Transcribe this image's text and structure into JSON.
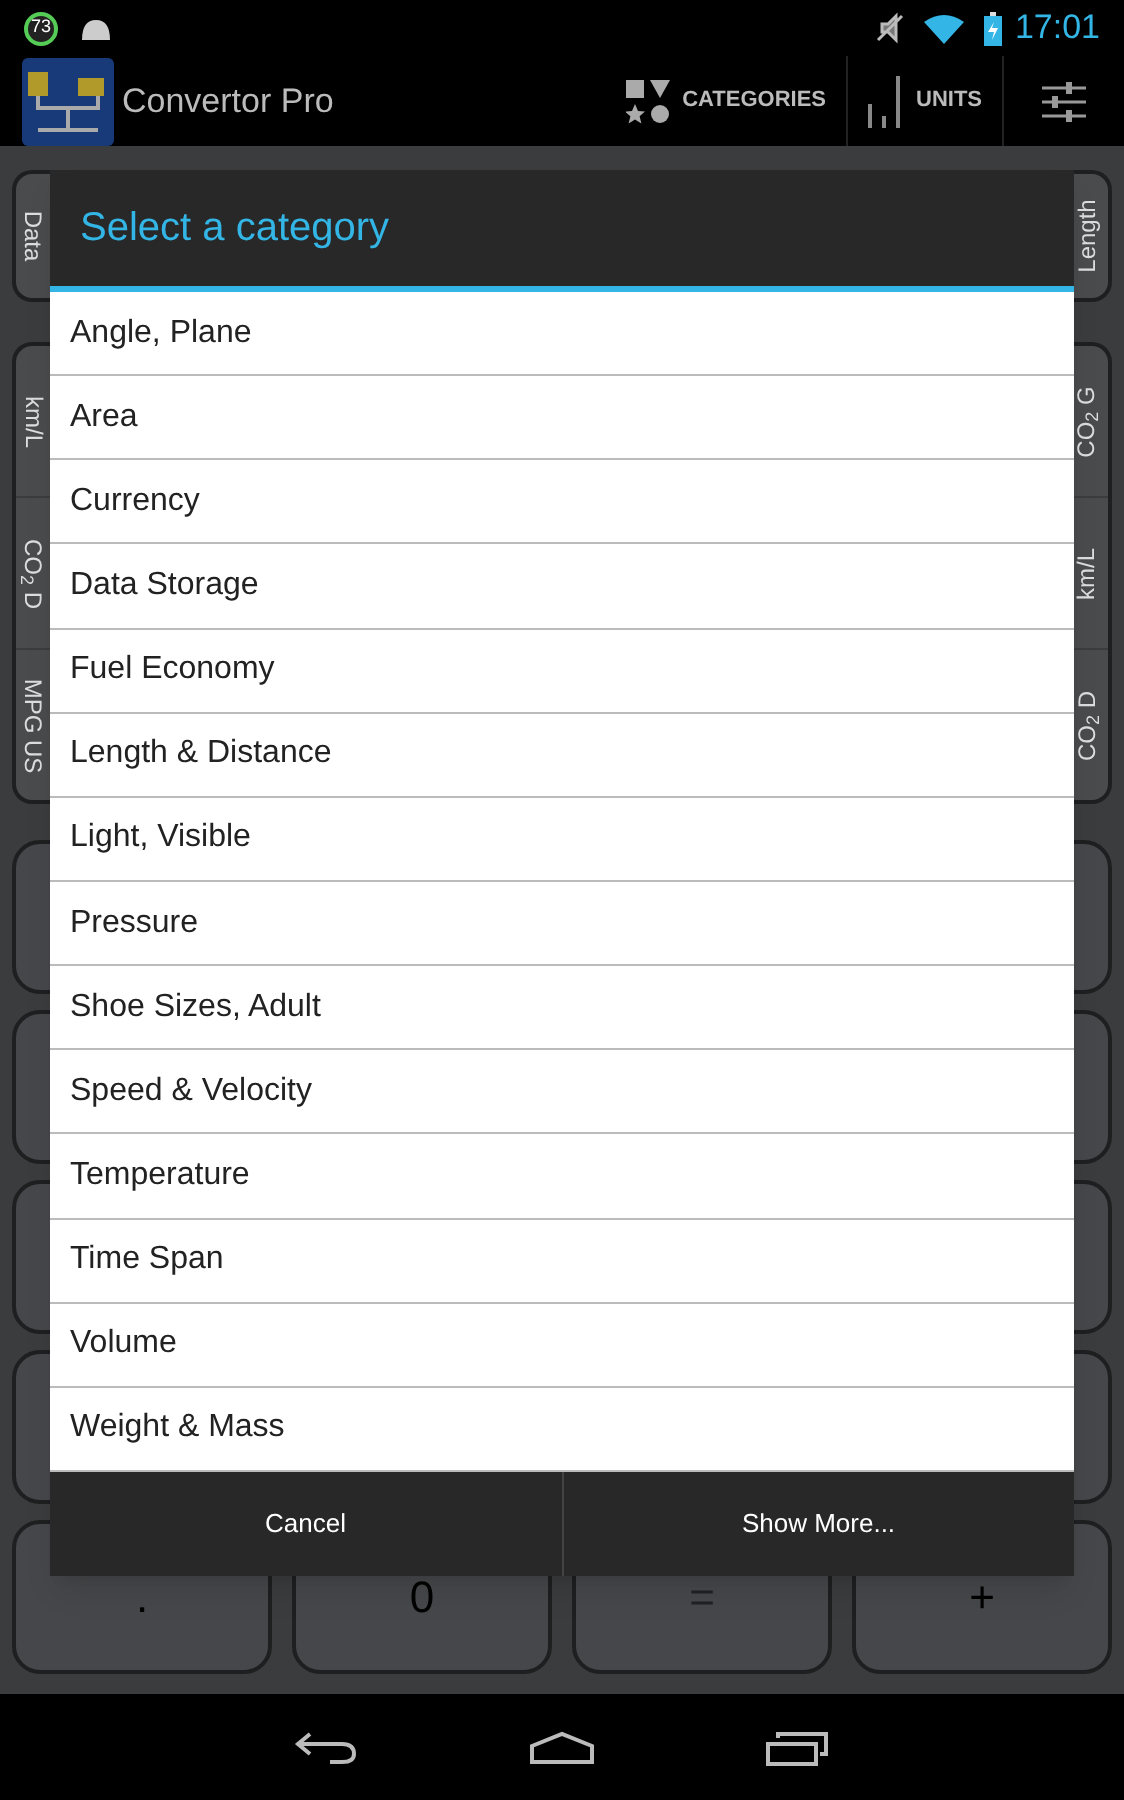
{
  "status_bar": {
    "badge": "73",
    "time": "17:01"
  },
  "action_bar": {
    "title": "Convertor Pro",
    "actions": [
      {
        "label": "CATEGORIES",
        "kind": "categories"
      },
      {
        "label": "UNITS",
        "kind": "units"
      }
    ]
  },
  "left_tabs": [
    {
      "labels": [
        "Data"
      ]
    },
    {
      "labels": [
        "km/L",
        "CO$_{2}$ D",
        "MPG US"
      ]
    }
  ],
  "right_tabs": [
    {
      "labels": [
        "Length"
      ]
    },
    {
      "labels": [
        "CO$_{2}$ G",
        "km/L",
        "CO$_{2}$ D"
      ]
    }
  ],
  "keypad_bottom_row": [
    {
      "label": ".",
      "disabled": false
    },
    {
      "label": "0",
      "disabled": false
    },
    {
      "label": "=",
      "disabled": true
    },
    {
      "label": "+",
      "disabled": false
    }
  ],
  "dialog": {
    "title": "Select a category",
    "items": [
      "Angle, Plane",
      "Area",
      "Currency",
      "Data Storage",
      "Fuel Economy",
      "Length & Distance",
      "Light, Visible",
      "Pressure",
      "Shoe Sizes, Adult",
      "Speed & Velocity",
      "Temperature",
      "Time Span",
      "Volume",
      "Weight & Mass"
    ],
    "buttons": [
      "Cancel",
      "Show More..."
    ]
  }
}
